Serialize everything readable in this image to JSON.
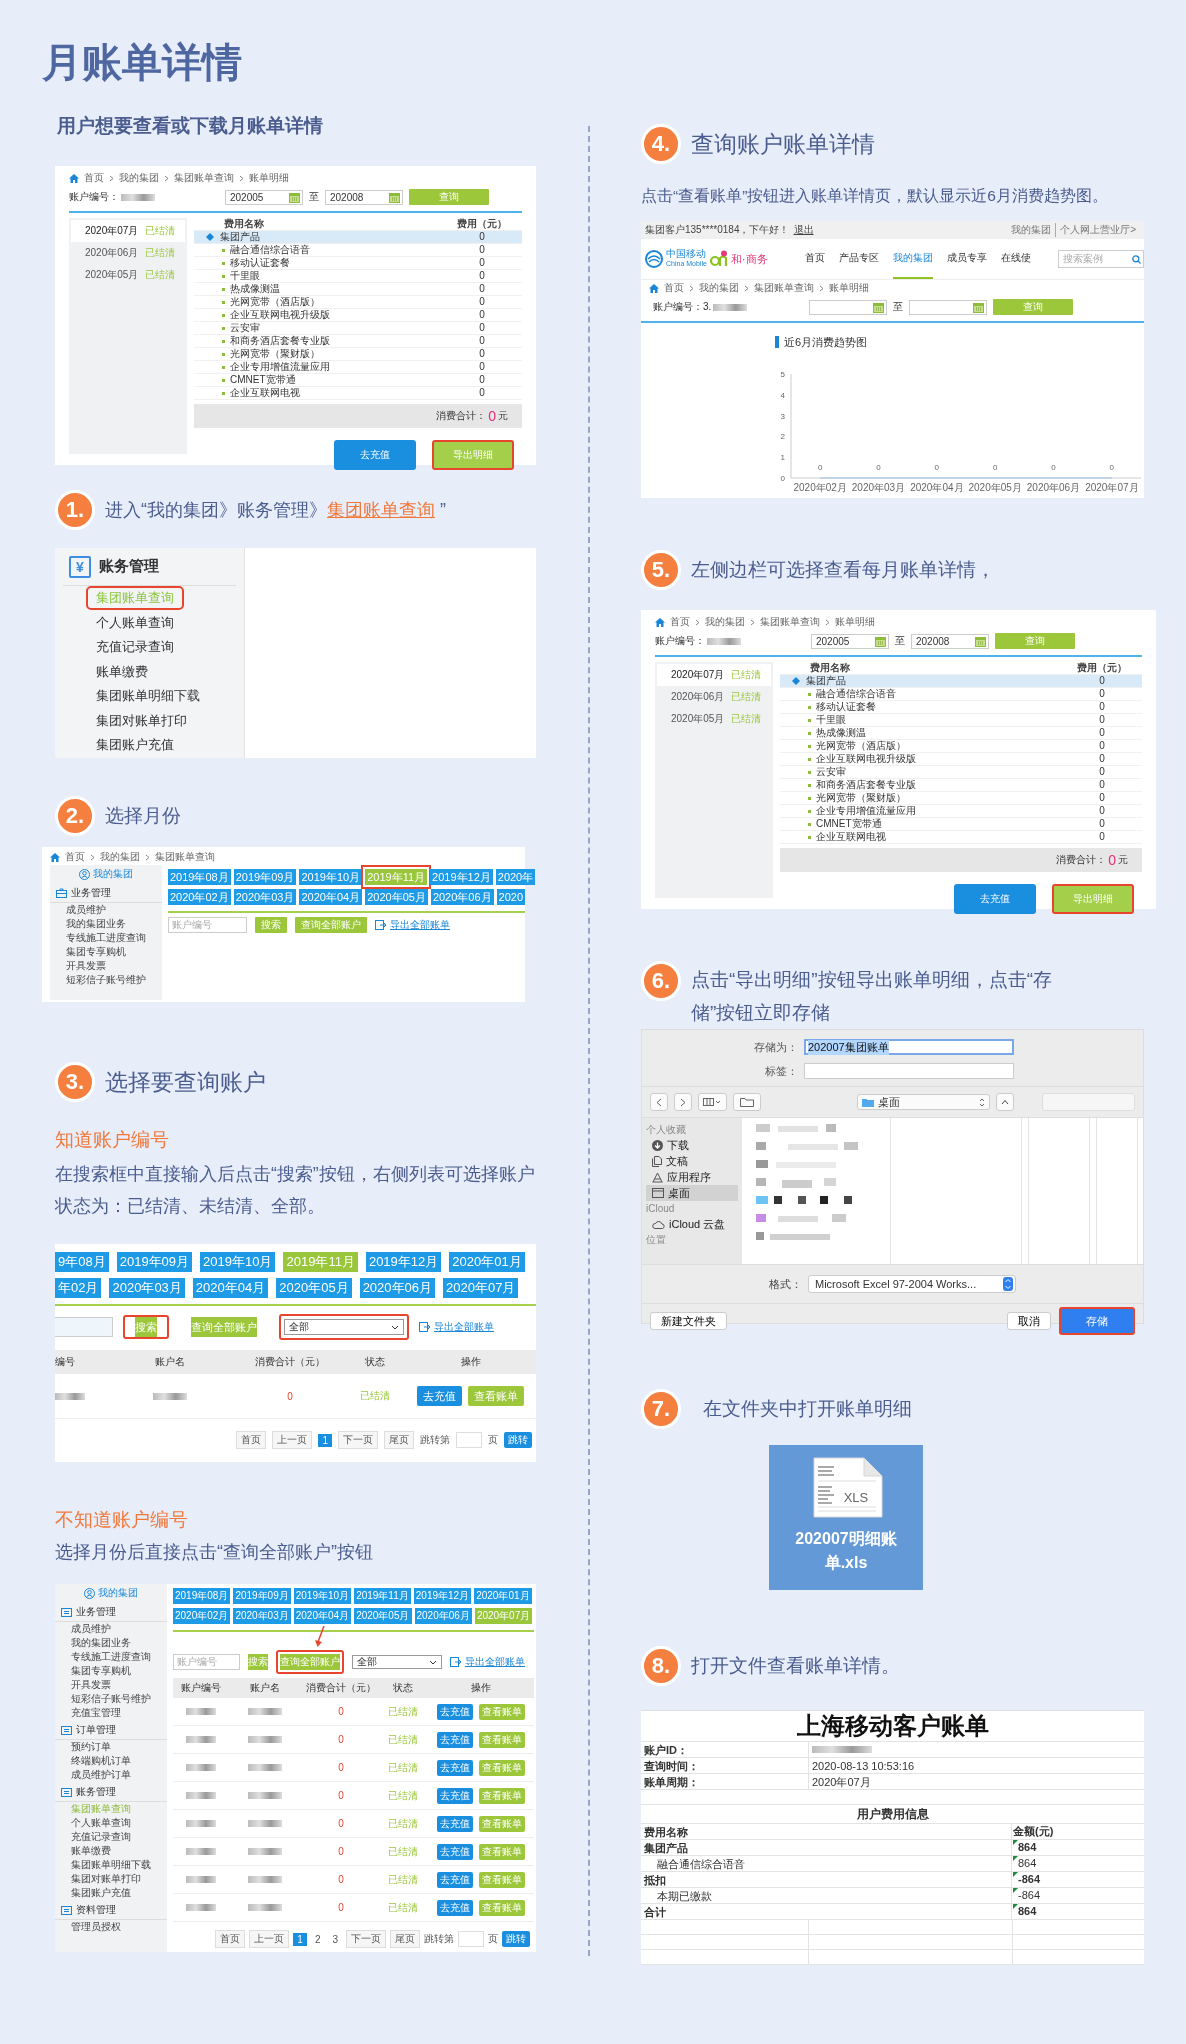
{
  "page": {
    "title": "月账单详情",
    "intro": "用户想要查看或下载月账单详情"
  },
  "bill_screen_a": {
    "breadcrumb": [
      "首页",
      "我的集团",
      "集团账单查询",
      "账单明细"
    ],
    "account_label": "账户编号：",
    "date_from": "202005",
    "to_label": "至",
    "date_to": "202008",
    "query_button": "查询",
    "months": [
      {
        "month": "2020年07月",
        "status": "已结清",
        "selected": true
      },
      {
        "month": "2020年06月",
        "status": "已结清",
        "selected": false
      },
      {
        "month": "2020年05月",
        "status": "已结清",
        "selected": false
      }
    ],
    "columns": [
      "费用名称",
      "费用（元）"
    ],
    "rows": [
      {
        "name": "集团产品",
        "amount": "0",
        "kind": "group"
      },
      {
        "name": "融合通信综合语音",
        "amount": "0",
        "kind": "item"
      },
      {
        "name": "移动认证套餐",
        "amount": "0",
        "kind": "item"
      },
      {
        "name": "千里眼",
        "amount": "0",
        "kind": "item"
      },
      {
        "name": "热成像测温",
        "amount": "0",
        "kind": "item"
      },
      {
        "name": "光网宽带（酒店版）",
        "amount": "0",
        "kind": "item"
      },
      {
        "name": "企业互联网电视升级版",
        "amount": "0",
        "kind": "item"
      },
      {
        "name": "云安审",
        "amount": "0",
        "kind": "item"
      },
      {
        "name": "和商务酒店套餐专业版",
        "amount": "0",
        "kind": "item"
      },
      {
        "name": "光网宽带（聚财版）",
        "amount": "0",
        "kind": "item"
      },
      {
        "name": "企业专用增值流量应用",
        "amount": "0",
        "kind": "item"
      },
      {
        "name": "CMNET宽带通",
        "amount": "0",
        "kind": "item"
      },
      {
        "name": "企业互联网电视",
        "amount": "0",
        "kind": "item"
      }
    ],
    "total_label": "消费合计：",
    "total_value": "0",
    "total_unit": "元",
    "buttons": [
      {
        "label": "去充值",
        "kind": "recharge",
        "highlighted": false
      },
      {
        "label": "导出明细",
        "kind": "export",
        "highlighted": true
      }
    ]
  },
  "step_1": {
    "number": "1.",
    "text_before": "进入“我的集团》账务管理》",
    "link": "集团账单查询",
    "text_after": " ”"
  },
  "menu_screen": {
    "icon": "¥",
    "heading": "账务管理",
    "items": [
      {
        "label": "集团账单查询",
        "selected": true
      },
      {
        "label": "个人账单查询",
        "selected": false
      },
      {
        "label": "充值记录查询",
        "selected": false
      },
      {
        "label": "账单缴费",
        "selected": false
      },
      {
        "label": "集团账单明细下载",
        "selected": false
      },
      {
        "label": "集团对账单打印",
        "selected": false
      },
      {
        "label": "集团账户充值",
        "selected": false
      }
    ]
  },
  "step_2": {
    "number": "2.",
    "text": "选择月份"
  },
  "month_screen": {
    "breadcrumb": [
      "首页",
      "我的集团",
      "集团账单查询"
    ],
    "sidebar_title": "我的集团",
    "sidebar_section": "业务管理",
    "sidebar_items": [
      "成员维护",
      "我的集团业务",
      "专线施工进度查询",
      "集团专享购机",
      "开具发票",
      "短彩信子账号维护"
    ],
    "month_rows": [
      [
        {
          "label": "2019年08月",
          "selected": false
        },
        {
          "label": "2019年09月",
          "selected": false
        },
        {
          "label": "2019年10月",
          "selected": false
        },
        {
          "label": "2019年11月",
          "selected": true
        },
        {
          "label": "2019年12月",
          "selected": false
        },
        {
          "label": "2020年",
          "selected": false
        }
      ],
      [
        {
          "label": "2020年02月",
          "selected": false
        },
        {
          "label": "2020年03月",
          "selected": false
        },
        {
          "label": "2020年04月",
          "selected": false
        },
        {
          "label": "2020年05月",
          "selected": false
        },
        {
          "label": "2020年06月",
          "selected": false
        },
        {
          "label": "2020",
          "selected": false
        }
      ]
    ],
    "search_placeholder": "账户编号",
    "search_button": "搜索",
    "query_all_button": "查询全部账户",
    "export_link": "导出全部账单"
  },
  "step_3": {
    "number": "3.",
    "text": "选择要查询账户"
  },
  "known_account": {
    "heading": "知道账户编号",
    "text": "在搜索框中直接输入后点击“搜索”按钮，右侧列表可选择账户状态为：已结清、未结清、全部。"
  },
  "search_screen": {
    "month_rows": [
      [
        {
          "label": "9年08月",
          "selected": false
        },
        {
          "label": "2019年09月",
          "selected": false
        },
        {
          "label": "2019年10月",
          "selected": false
        },
        {
          "label": "2019年11月",
          "selected": true
        },
        {
          "label": "2019年12月",
          "selected": false
        },
        {
          "label": "2020年01月",
          "selected": false
        }
      ],
      [
        {
          "label": "年02月",
          "selected": false
        },
        {
          "label": "2020年03月",
          "selected": false
        },
        {
          "label": "2020年04月",
          "selected": false
        },
        {
          "label": "2020年05月",
          "selected": false
        },
        {
          "label": "2020年06月",
          "selected": false
        },
        {
          "label": "2020年07月",
          "selected": false
        }
      ]
    ],
    "search_button": {
      "label": "搜索",
      "highlighted": true
    },
    "query_all_button": {
      "label": "查询全部账户",
      "highlighted": false
    },
    "status_select": {
      "value": "全部",
      "highlighted": true
    },
    "export_link": "导出全部账单",
    "columns": [
      "编号",
      "账户名",
      "消费合计（元）",
      "状态",
      "操作"
    ],
    "rows": [
      {
        "total": "0",
        "status": "已结清",
        "actions": [
          "去充值",
          "查看账单"
        ]
      }
    ],
    "pagination": {
      "first": "首页",
      "prev": "上一页",
      "pages": [
        {
          "label": "1",
          "selected": true
        }
      ],
      "next": "下一页",
      "last": "尾页",
      "jump_label": "跳转第",
      "page_unit": "页",
      "jump_button": "跳转"
    }
  },
  "unknown_account": {
    "heading": "不知道账户编号",
    "text": "选择月份后直接点击“查询全部账户”按钮"
  },
  "all_accounts_screen": {
    "sidebar_title": "我的集团",
    "sidebar_groups": [
      {
        "heading": "业务管理",
        "items": [
          {
            "label": "成员维护",
            "selected": false
          },
          {
            "label": "我的集团业务",
            "selected": false
          },
          {
            "label": "专线施工进度查询",
            "selected": false
          },
          {
            "label": "集团专享购机",
            "selected": false
          },
          {
            "label": "开具发票",
            "selected": false
          },
          {
            "label": "短彩信子账号维护",
            "selected": false
          },
          {
            "label": "充值宝管理",
            "selected": false
          }
        ]
      },
      {
        "heading": "订单管理",
        "items": [
          {
            "label": "预约订单",
            "selected": false
          },
          {
            "label": "终端购机订单",
            "selected": false
          },
          {
            "label": "成员维护订单",
            "selected": false
          }
        ]
      },
      {
        "heading": "账务管理",
        "items": [
          {
            "label": "集团账单查询",
            "selected": true
          },
          {
            "label": "个人账单查询",
            "selected": false
          },
          {
            "label": "充值记录查询",
            "selected": false
          },
          {
            "label": "账单缴费",
            "selected": false
          },
          {
            "label": "集团账单明细下载",
            "selected": false
          },
          {
            "label": "集团对账单打印",
            "selected": false
          },
          {
            "label": "集团账户充值",
            "selected": false
          }
        ]
      },
      {
        "heading": "资料管理",
        "items": [
          {
            "label": "管理员授权",
            "selected": false
          }
        ]
      }
    ],
    "month_rows": [
      [
        {
          "label": "2019年08月",
          "selected": false
        },
        {
          "label": "2019年09月",
          "selected": false
        },
        {
          "label": "2019年10月",
          "selected": false
        },
        {
          "label": "2019年11月",
          "selected": false
        },
        {
          "label": "2019年12月",
          "selected": false
        },
        {
          "label": "2020年01月",
          "selected": false
        }
      ],
      [
        {
          "label": "2020年02月",
          "selected": false
        },
        {
          "label": "2020年03月",
          "selected": false
        },
        {
          "label": "2020年04月",
          "selected": false
        },
        {
          "label": "2020年05月",
          "selected": false
        },
        {
          "label": "2020年06月",
          "selected": false
        },
        {
          "label": "2020年07月",
          "selected": true
        }
      ]
    ],
    "search_placeholder": "账户编号",
    "search_button": {
      "label": "搜索",
      "highlighted": false
    },
    "query_all_button": {
      "label": "查询全部账户",
      "highlighted": true
    },
    "status_select": {
      "value": "全部",
      "highlighted": false
    },
    "export_link": "导出全部账单",
    "columns": [
      "账户编号",
      "账户名",
      "消费合计（元）",
      "状态",
      "操作"
    ],
    "rows": [
      {
        "total": "0",
        "status": "已结清",
        "actions": [
          "去充值",
          "查看账单"
        ]
      },
      {
        "total": "0",
        "status": "已结清",
        "actions": [
          "去充值",
          "查看账单"
        ]
      },
      {
        "total": "0",
        "status": "已结清",
        "actions": [
          "去充值",
          "查看账单"
        ]
      },
      {
        "total": "0",
        "status": "已结清",
        "actions": [
          "去充值",
          "查看账单"
        ]
      },
      {
        "total": "0",
        "status": "已结清",
        "actions": [
          "去充值",
          "查看账单"
        ]
      },
      {
        "total": "0",
        "status": "已结清",
        "actions": [
          "去充值",
          "查看账单"
        ]
      },
      {
        "total": "0",
        "status": "已结清",
        "actions": [
          "去充值",
          "查看账单"
        ]
      },
      {
        "total": "0",
        "status": "已结清",
        "actions": [
          "去充值",
          "查看账单"
        ]
      }
    ],
    "pagination": {
      "first": "首页",
      "prev": "上一页",
      "pages": [
        {
          "label": "1",
          "selected": true
        },
        {
          "label": "2",
          "selected": false
        },
        {
          "label": "3",
          "selected": false
        }
      ],
      "next": "下一页",
      "last": "尾页",
      "jump_label": "跳转第",
      "page_unit": "页",
      "jump_button": "跳转"
    }
  },
  "step_4": {
    "number": "4.",
    "text": "查询账户账单详情",
    "description": "点击“查看账单”按钮进入账单详情页，默认显示近6月消费趋势图。"
  },
  "chart_screen": {
    "greeting": "集团客户135****0184，下午好！",
    "logout": "退出",
    "top_links": [
      "我的集团",
      "个人网上营业厅>"
    ],
    "logo_cn": "中国移动",
    "logo_en": "China Mobile",
    "brand": "和·商务",
    "nav": [
      {
        "label": "首页",
        "selected": false
      },
      {
        "label": "产品专区",
        "selected": false
      },
      {
        "label": "我的集团",
        "selected": true
      },
      {
        "label": "成员专享",
        "selected": false
      },
      {
        "label": "在线使",
        "selected": false
      }
    ],
    "search_placeholder": "搜索案例",
    "breadcrumb": [
      "首页",
      "我的集团",
      "集团账单查询",
      "账单明细"
    ],
    "account_label": "账户编号：3.",
    "to_label": "至",
    "query_button": "查询",
    "chart_data": {
      "type": "line",
      "title": "近6月消费趋势图",
      "categories": [
        "2020年02月",
        "2020年03月",
        "2020年04月",
        "2020年05月",
        "2020年06月",
        "2020年07月"
      ],
      "series": [
        {
          "values": [
            0,
            0,
            0,
            0,
            0,
            0
          ]
        }
      ],
      "ylim": [
        0,
        5
      ],
      "yticks": [
        0,
        1,
        2,
        3,
        4,
        5
      ],
      "data_labels": true
    }
  },
  "step_5": {
    "number": "5.",
    "text": "左侧边栏可选择查看每月账单详情，"
  },
  "bill_screen_b": {
    "breadcrumb": [
      "首页",
      "我的集团",
      "集团账单查询",
      "账单明细"
    ],
    "account_label": "账户编号：",
    "date_from": "202005",
    "to_label": "至",
    "date_to": "202008",
    "query_button": "查询",
    "months": [
      {
        "month": "2020年07月",
        "status": "已结清",
        "selected": true
      },
      {
        "month": "2020年06月",
        "status": "已结清",
        "selected": false
      },
      {
        "month": "2020年05月",
        "status": "已结清",
        "selected": false
      }
    ],
    "columns": [
      "费用名称",
      "费用（元）"
    ],
    "rows": [
      {
        "name": "集团产品",
        "amount": "0",
        "kind": "group"
      },
      {
        "name": "融合通信综合语音",
        "amount": "0",
        "kind": "item"
      },
      {
        "name": "移动认证套餐",
        "amount": "0",
        "kind": "item"
      },
      {
        "name": "千里眼",
        "amount": "0",
        "kind": "item"
      },
      {
        "name": "热成像测温",
        "amount": "0",
        "kind": "item"
      },
      {
        "name": "光网宽带（酒店版）",
        "amount": "0",
        "kind": "item"
      },
      {
        "name": "企业互联网电视升级版",
        "amount": "0",
        "kind": "item"
      },
      {
        "name": "云安审",
        "amount": "0",
        "kind": "item"
      },
      {
        "name": "和商务酒店套餐专业版",
        "amount": "0",
        "kind": "item"
      },
      {
        "name": "光网宽带（聚财版）",
        "amount": "0",
        "kind": "item"
      },
      {
        "name": "企业专用增值流量应用",
        "amount": "0",
        "kind": "item"
      },
      {
        "name": "CMNET宽带通",
        "amount": "0",
        "kind": "item"
      },
      {
        "name": "企业互联网电视",
        "amount": "0",
        "kind": "item"
      }
    ],
    "total_label": "消费合计：",
    "total_value": "0",
    "total_unit": "元",
    "buttons": [
      {
        "label": "去充值",
        "kind": "recharge",
        "highlighted": false
      },
      {
        "label": "导出明细",
        "kind": "export",
        "highlighted": true
      }
    ]
  },
  "step_6": {
    "number": "6.",
    "text": "点击“导出明细”按钮导出账单明细，点击“存储”按钮立即存储"
  },
  "save_dialog": {
    "save_as_label": "存储为：",
    "file_name": "202007集团账单",
    "tags_label": "标签：",
    "location": "桌面",
    "sidebar_groups": [
      {
        "heading": "个人收藏",
        "items": [
          {
            "label": "下载",
            "selected": false
          },
          {
            "label": "文稿",
            "selected": false
          },
          {
            "label": "应用程序",
            "selected": false
          },
          {
            "label": "桌面",
            "selected": true
          }
        ]
      },
      {
        "heading": "iCloud",
        "items": [
          {
            "label": "iCloud 云盘",
            "selected": false
          }
        ]
      },
      {
        "heading": "位置"
      }
    ],
    "format_label": "格式：",
    "format": "Microsoft Excel 97-2004 Works...",
    "new_folder_button": "新建文件夹",
    "cancel_button": "取消",
    "save_button": {
      "label": "存储",
      "highlighted": true
    }
  },
  "step_7": {
    "number": "7.",
    "text": "在文件夹中打开账单明细"
  },
  "file_icon": {
    "badge": "XLS",
    "name": "202007明细账单.xls"
  },
  "step_8": {
    "number": "8.",
    "text": "打开文件查看账单详情。"
  },
  "spreadsheet": {
    "title": "上海移动客户账单",
    "info": [
      {
        "label": "账户ID："
      },
      {
        "label": "查询时间：",
        "value": "2020-08-13 10:53:16"
      },
      {
        "label": "账单周期：",
        "value": "2020年07月"
      }
    ],
    "section_title": "用户费用信息",
    "columns": [
      "费用名称",
      "金额(元)"
    ],
    "rows": [
      {
        "name": "集团产品",
        "amount": "864",
        "kind": "group"
      },
      {
        "name": "融合通信综合语音",
        "amount": "864",
        "kind": "item"
      },
      {
        "name": "抵扣",
        "amount": "-864",
        "kind": "group"
      },
      {
        "name": "本期已缴款",
        "amount": "-864",
        "kind": "item"
      },
      {
        "name": "合计",
        "amount": "864",
        "kind": "group"
      }
    ]
  }
}
